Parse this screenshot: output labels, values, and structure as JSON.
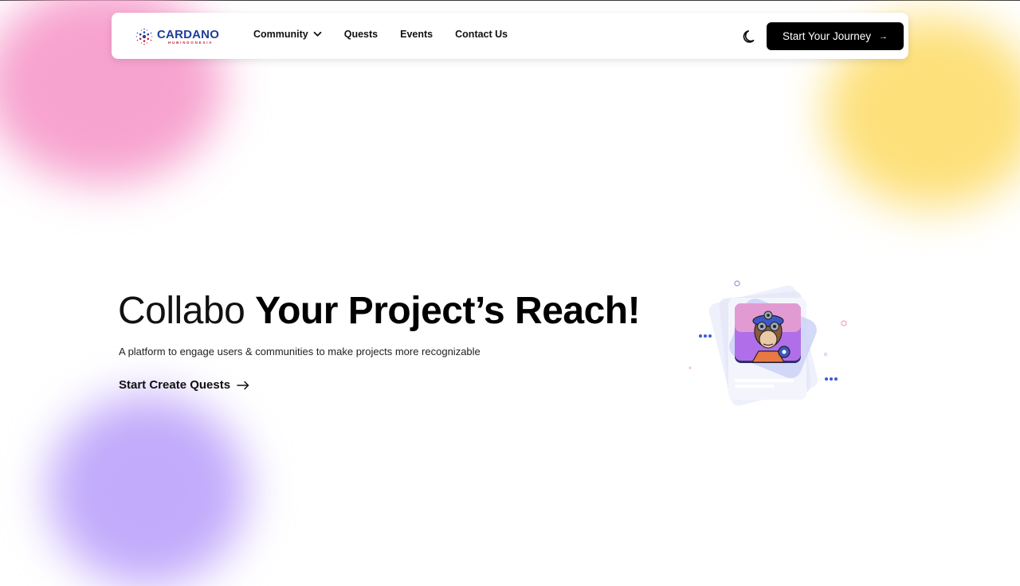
{
  "brand": {
    "name": "CARDANO",
    "tagline": "HUBINDONESIA"
  },
  "nav": {
    "items": [
      {
        "label": "Community",
        "has_dropdown": true
      },
      {
        "label": "Quests"
      },
      {
        "label": "Events"
      },
      {
        "label": "Contact Us"
      }
    ],
    "theme_toggle_icon": "moon-icon",
    "cta_label": "Start Your Journey",
    "cta_icon": "arrow-right-icon"
  },
  "hero": {
    "title_light": "Collabo ",
    "title_bold": "Your Project’s Reach!",
    "subtitle": "A platform to engage users & communities to make projects more recognizable",
    "link_label": "Start Create Quests",
    "link_icon": "arrow-right-icon"
  },
  "colors": {
    "brand_blue": "#1f3d9a",
    "brand_red": "#c21f3b",
    "cta_bg": "#000000",
    "blob_pink": "#f7a3cf",
    "blob_yellow": "#fde07a",
    "blob_purple": "#c2abfb"
  }
}
